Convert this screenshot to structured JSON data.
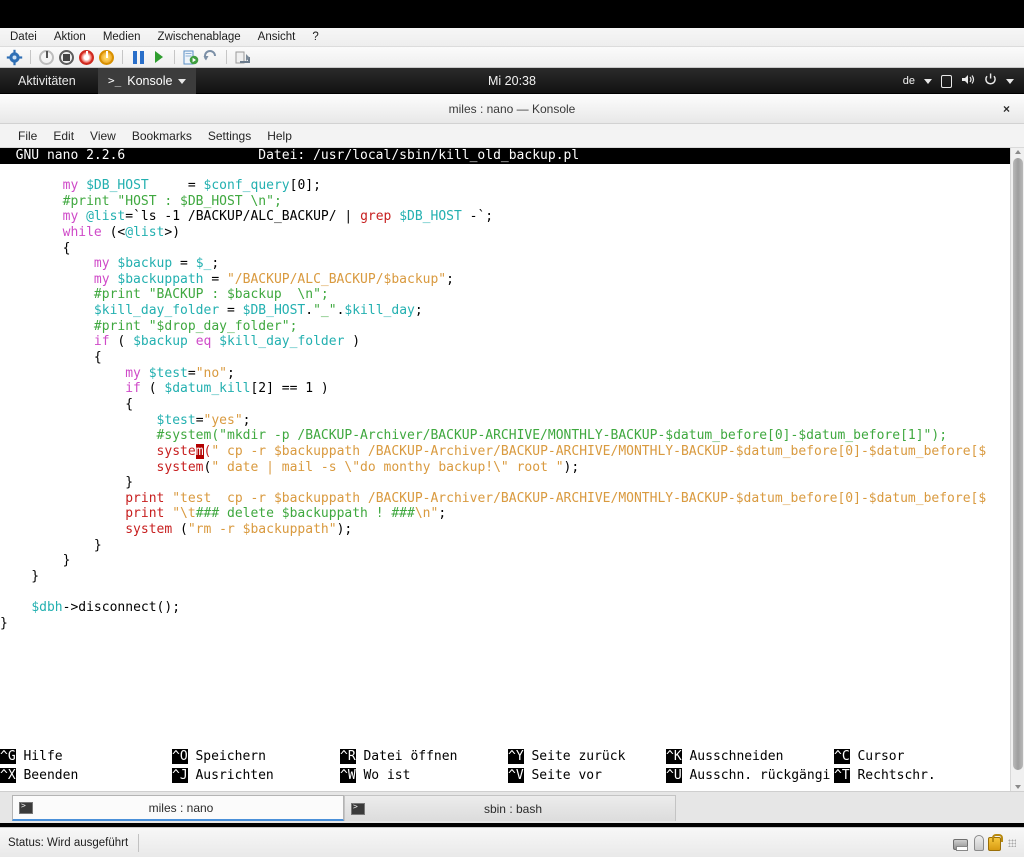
{
  "vm": {
    "menu": [
      "Datei",
      "Aktion",
      "Medien",
      "Zwischenablage",
      "Ansicht",
      "?"
    ],
    "toolbar_icons": [
      "settings-icon",
      "power-off-icon",
      "stop-icon",
      "reset-icon",
      "shutdown-icon",
      "pause-icon",
      "start-icon",
      "snapshot-icon",
      "revert-icon",
      "discard-icon"
    ],
    "status_label": "Status: Wird ausgeführt",
    "status_icons": [
      "harddisk-icon",
      "usb-icon",
      "lock-icon",
      "resize-grip-icon"
    ]
  },
  "gnome_panel": {
    "activities": "Aktivitäten",
    "app_name": "Konsole",
    "app_icon": ">_",
    "clock": "Mi 20:38",
    "keyboard_layout": "de",
    "tray_icons": [
      "display-icon",
      "volume-icon",
      "power-icon"
    ]
  },
  "konsole": {
    "window_title": "miles : nano — Konsole",
    "close_label": "×",
    "menu": [
      "File",
      "Edit",
      "View",
      "Bookmarks",
      "Settings",
      "Help"
    ],
    "tabs": [
      {
        "label": "miles : nano",
        "active": true,
        "icon": "terminal-icon"
      },
      {
        "label": "sbin : bash",
        "active": false,
        "icon": "terminal-icon"
      }
    ]
  },
  "nano": {
    "version_label": "GNU nano 2.2.6",
    "file_label": "Datei: /usr/local/sbin/kill_old_backup.pl",
    "title_bar_text": "  GNU nano 2.2.6                 Datei: /usr/local/sbin/kill_old_backup.pl",
    "cursor": {
      "line": 13,
      "char": "m",
      "token": "system"
    },
    "code_lines": [
      [
        {
          "t": "        ",
          "c": "pl"
        },
        {
          "t": "my",
          "c": "kwm"
        },
        {
          "t": " ",
          "c": "pl"
        },
        {
          "t": "$DB_HOST",
          "c": "var"
        },
        {
          "t": "     = ",
          "c": "pl"
        },
        {
          "t": "$conf_query",
          "c": "var"
        },
        {
          "t": "[",
          "c": "pl"
        },
        {
          "t": "0",
          "c": "pl"
        },
        {
          "t": "];",
          "c": "pl"
        }
      ],
      [
        {
          "t": "        ",
          "c": "pl"
        },
        {
          "t": "#print \"HOST : $DB_HOST \\n\";",
          "c": "cmt"
        }
      ],
      [
        {
          "t": "        ",
          "c": "pl"
        },
        {
          "t": "my",
          "c": "kwm"
        },
        {
          "t": " ",
          "c": "pl"
        },
        {
          "t": "@list",
          "c": "var"
        },
        {
          "t": "=`ls -1 /BACKUP/ALC_BACKUP/ | ",
          "c": "pl"
        },
        {
          "t": "grep",
          "c": "kw"
        },
        {
          "t": " ",
          "c": "pl"
        },
        {
          "t": "$DB_HOST",
          "c": "var"
        },
        {
          "t": " -`;",
          "c": "pl"
        }
      ],
      [
        {
          "t": "        ",
          "c": "pl"
        },
        {
          "t": "while",
          "c": "kwm"
        },
        {
          "t": " (<",
          "c": "pl"
        },
        {
          "t": "@list",
          "c": "var"
        },
        {
          "t": ">)",
          "c": "pl"
        }
      ],
      [
        {
          "t": "        {",
          "c": "pl"
        }
      ],
      [
        {
          "t": "            ",
          "c": "pl"
        },
        {
          "t": "my",
          "c": "kwm"
        },
        {
          "t": " ",
          "c": "pl"
        },
        {
          "t": "$backup",
          "c": "var"
        },
        {
          "t": " = ",
          "c": "pl"
        },
        {
          "t": "$_",
          "c": "var"
        },
        {
          "t": ";",
          "c": "pl"
        }
      ],
      [
        {
          "t": "            ",
          "c": "pl"
        },
        {
          "t": "my",
          "c": "kwm"
        },
        {
          "t": " ",
          "c": "pl"
        },
        {
          "t": "$backuppath",
          "c": "var"
        },
        {
          "t": " = ",
          "c": "pl"
        },
        {
          "t": "\"/BACKUP/ALC_BACKUP/$backup\"",
          "c": "pth"
        },
        {
          "t": ";",
          "c": "pl"
        }
      ],
      [
        {
          "t": "            ",
          "c": "pl"
        },
        {
          "t": "#print \"BACKUP : $backup  \\n\";",
          "c": "cmt"
        }
      ],
      [
        {
          "t": "            ",
          "c": "pl"
        },
        {
          "t": "$kill_day_folder",
          "c": "var"
        },
        {
          "t": " = ",
          "c": "pl"
        },
        {
          "t": "$DB_HOST",
          "c": "var"
        },
        {
          "t": ".",
          "c": "pl"
        },
        {
          "t": "\"_\"",
          "c": "str"
        },
        {
          "t": ".",
          "c": "pl"
        },
        {
          "t": "$kill_day",
          "c": "var"
        },
        {
          "t": ";",
          "c": "pl"
        }
      ],
      [
        {
          "t": "            ",
          "c": "pl"
        },
        {
          "t": "#print \"$drop_day_folder\";",
          "c": "cmt"
        }
      ],
      [
        {
          "t": "            ",
          "c": "pl"
        },
        {
          "t": "if",
          "c": "kwm"
        },
        {
          "t": " ( ",
          "c": "pl"
        },
        {
          "t": "$backup",
          "c": "var"
        },
        {
          "t": " ",
          "c": "pl"
        },
        {
          "t": "eq",
          "c": "kwm"
        },
        {
          "t": " ",
          "c": "pl"
        },
        {
          "t": "$kill_day_folder",
          "c": "var"
        },
        {
          "t": " )",
          "c": "pl"
        }
      ],
      [
        {
          "t": "            {",
          "c": "pl"
        }
      ],
      [
        {
          "t": "                ",
          "c": "pl"
        },
        {
          "t": "my",
          "c": "kwm"
        },
        {
          "t": " ",
          "c": "pl"
        },
        {
          "t": "$test",
          "c": "var"
        },
        {
          "t": "=",
          "c": "pl"
        },
        {
          "t": "\"no\"",
          "c": "pth"
        },
        {
          "t": ";",
          "c": "pl"
        }
      ],
      [
        {
          "t": "                ",
          "c": "pl"
        },
        {
          "t": "if",
          "c": "kwm"
        },
        {
          "t": " ( ",
          "c": "pl"
        },
        {
          "t": "$datum_kill",
          "c": "var"
        },
        {
          "t": "[",
          "c": "pl"
        },
        {
          "t": "2",
          "c": "pl"
        },
        {
          "t": "] == ",
          "c": "pl"
        },
        {
          "t": "1",
          "c": "pl"
        },
        {
          "t": " )",
          "c": "pl"
        }
      ],
      [
        {
          "t": "                {",
          "c": "pl"
        }
      ],
      [
        {
          "t": "                    ",
          "c": "pl"
        },
        {
          "t": "$test",
          "c": "var"
        },
        {
          "t": "=",
          "c": "pl"
        },
        {
          "t": "\"yes\"",
          "c": "pth"
        },
        {
          "t": ";",
          "c": "pl"
        }
      ],
      [
        {
          "t": "                    ",
          "c": "pl"
        },
        {
          "t": "#system(\"mkdir -p /BACKUP-Archiver/BACKUP-ARCHIVE/MONTHLY-BACKUP-$datum_before[0]-$datum_before[1]\");",
          "c": "cmt"
        }
      ],
      [
        {
          "t": "                    ",
          "c": "pl"
        },
        {
          "t": "syste",
          "c": "kw"
        },
        {
          "t": "m",
          "c": "cur"
        },
        {
          "t": "(",
          "c": "kw"
        },
        {
          "t": "\" cp -r $backuppath /BACKUP-Archiver/BACKUP-ARCHIVE/MONTHLY-BACKUP-$datum_before[0]-$datum_before[$",
          "c": "pth"
        }
      ],
      [
        {
          "t": "                    ",
          "c": "pl"
        },
        {
          "t": "system",
          "c": "kw"
        },
        {
          "t": "(",
          "c": "pl"
        },
        {
          "t": "\" date | mail -s \\\"do monthy backup!\\\" root \"",
          "c": "pth"
        },
        {
          "t": ");",
          "c": "pl"
        }
      ],
      [
        {
          "t": "                }",
          "c": "pl"
        }
      ],
      [
        {
          "t": "                ",
          "c": "pl"
        },
        {
          "t": "print",
          "c": "kw"
        },
        {
          "t": " ",
          "c": "pl"
        },
        {
          "t": "\"test  cp -r $backuppath /BACKUP-Archiver/BACKUP-ARCHIVE/MONTHLY-BACKUP-$datum_before[0]-$datum_before[$",
          "c": "pth"
        }
      ],
      [
        {
          "t": "                ",
          "c": "pl"
        },
        {
          "t": "print",
          "c": "kw"
        },
        {
          "t": " ",
          "c": "pl"
        },
        {
          "t": "\"\\t",
          "c": "pth"
        },
        {
          "t": "### delete $backuppath ! ###",
          "c": "str"
        },
        {
          "t": "\\n\"",
          "c": "pth"
        },
        {
          "t": ";",
          "c": "pl"
        }
      ],
      [
        {
          "t": "                ",
          "c": "pl"
        },
        {
          "t": "system",
          "c": "kw"
        },
        {
          "t": " (",
          "c": "pl"
        },
        {
          "t": "\"rm -r $backuppath\"",
          "c": "pth"
        },
        {
          "t": ");",
          "c": "pl"
        }
      ],
      [
        {
          "t": "            }",
          "c": "pl"
        }
      ],
      [
        {
          "t": "        }",
          "c": "pl"
        }
      ],
      [
        {
          "t": "    }",
          "c": "pl"
        }
      ],
      [
        {
          "t": "",
          "c": "pl"
        }
      ],
      [
        {
          "t": "    ",
          "c": "pl"
        },
        {
          "t": "$dbh",
          "c": "var"
        },
        {
          "t": "->disconnect();",
          "c": "pl"
        }
      ],
      [
        {
          "t": "}",
          "c": "pl"
        }
      ]
    ],
    "help_rows": [
      [
        {
          "key": "^G",
          "label": "Hilfe"
        },
        {
          "key": "^O",
          "label": "Speichern"
        },
        {
          "key": "^R",
          "label": "Datei öffnen"
        },
        {
          "key": "^Y",
          "label": "Seite zurück"
        },
        {
          "key": "^K",
          "label": "Ausschneiden"
        },
        {
          "key": "^C",
          "label": "Cursor"
        }
      ],
      [
        {
          "key": "^X",
          "label": "Beenden"
        },
        {
          "key": "^J",
          "label": "Ausrichten"
        },
        {
          "key": "^W",
          "label": "Wo ist"
        },
        {
          "key": "^V",
          "label": "Seite vor"
        },
        {
          "key": "^U",
          "label": "Ausschn. rückgängi"
        },
        {
          "key": "^T",
          "label": "Rechtschr."
        }
      ]
    ]
  },
  "colors": {
    "terminal_bg": "#ffffff",
    "terminal_fg": "#000000",
    "keyword": "#c71f1f",
    "keyword_alt": "#cf4ac8",
    "variable": "#23b0b0",
    "string": "#3fa83f",
    "path": "#d99a3f",
    "comment": "#3fa83f",
    "cursor_bg": "#b30000",
    "tab_accent": "#4a90d9"
  }
}
